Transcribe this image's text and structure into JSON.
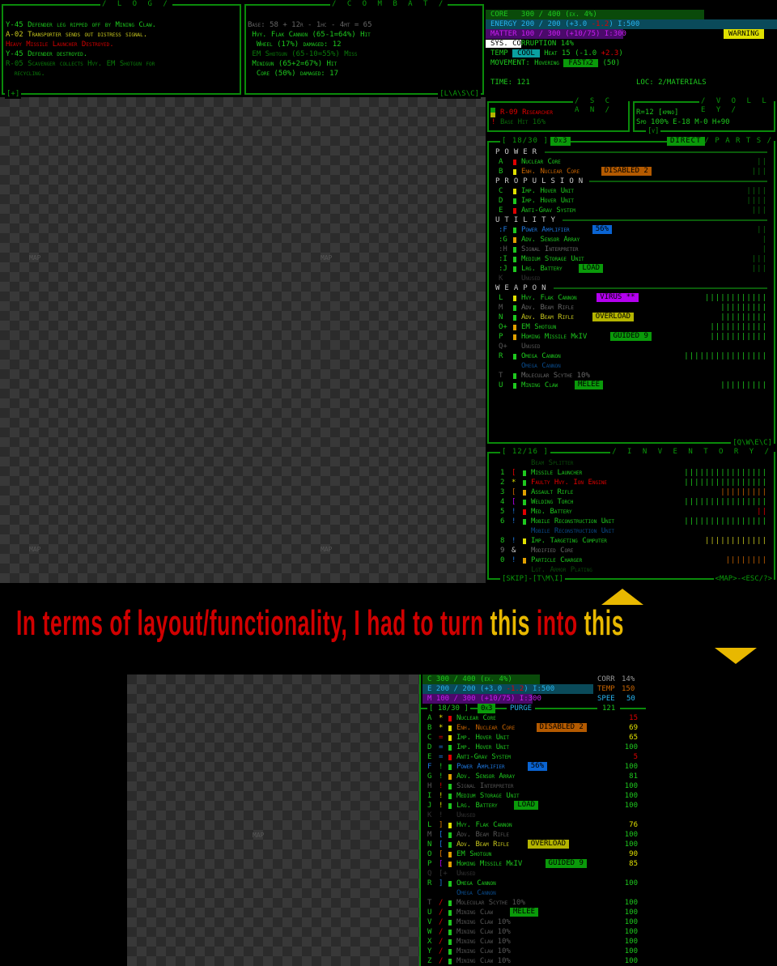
{
  "colors": {
    "green": "#1ec81e",
    "accent": "#0a8a0a",
    "caption_red": "#d00000",
    "caption_yellow": "#e8b800"
  },
  "log": {
    "title": "/ L O G /",
    "footer": "[+]",
    "lines": [
      {
        "text": "Y-45 Defender leg ripped off by Mining Claw.",
        "color": "#1ec81e"
      },
      {
        "text": "A-02 Transporter sends out distress signal.",
        "color": "#c8c81e"
      },
      {
        "text": "Heavy Missile Launcher Destroyed.",
        "color": "#d00000"
      },
      {
        "text": "Y-45 Defender destroyed.",
        "color": "#1ec81e"
      },
      {
        "text": "R-05 Scavenger collects Hvy. EM Shotgun for",
        "color": "#0a7a0a"
      },
      {
        "text": "  recycling.",
        "color": "#0a7a0a"
      }
    ]
  },
  "combat": {
    "title": "/ C O M B A T /",
    "footer": "[L\\A\\S\\C]",
    "lines": [
      {
        "text": "Base: 58 + 12r - 1hc - 4mt = 65",
        "color": "#666"
      },
      {
        "text": " Hvy. Flak Cannon (65-1=64%) Hit",
        "color": "#1ec81e"
      },
      {
        "text": "  Wheel (17%) damaged: 12",
        "color": "#1ec81e"
      },
      {
        "text": " EM Shotgun (65-10=55%) Miss",
        "color": "#0a7a0a"
      },
      {
        "text": " Minigun (65+2=67%) Hit",
        "color": "#1ec81e"
      },
      {
        "text": "  Core (50%) damaged: 17",
        "color": "#1ec81e"
      }
    ]
  },
  "status": {
    "core": "CORE   300 / 400 (ex. 4%)",
    "energy": "ENERGY 200 / 200 (+3.0 ",
    "energy_neg": "-1.2",
    "energy_end": ") I:500",
    "matter": "MATTER 100 / 300 (+10/75) I:300",
    "warning": "WARNING",
    "corruption_hl": "SYS. CO",
    "corruption_rest": "RRUPTION 14%",
    "temp_label": "TEMP ",
    "temp_state": "COOL",
    "heat": " Heat 15 (-1.0 ",
    "heat_pos": "+2.3",
    "heat_end": ")",
    "movement": "MOVEMENT: Hovering ",
    "speed_tag": "FASTx2",
    "speed_val": " (50)",
    "time": "TIME: 121",
    "loc": "LOC: 2/MATERIALS"
  },
  "scan": {
    "title": "/ S C A N /",
    "target": "R-09 Researcher",
    "hit": "Base Hit 16%",
    "hit_icon": "!"
  },
  "volley": {
    "title": "/ V O L L E Y /",
    "range": "R=12 [kmno]",
    "stats": "Spd 100% E-18 M-0 H+90",
    "footer": "[v]"
  },
  "parts": {
    "title": "/ P A R T S /",
    "count": "[ 18/30 ]",
    "mode": "0x3",
    "direct": "DIRECT",
    "footer": "[Q\\W\\E\\C]",
    "rows": [
      {
        "section": "POWER"
      },
      {
        "key": "A",
        "marker": "#e00000",
        "name": "Nuclear Core",
        "color": "#1ec81e",
        "bars": "||",
        "barcolor": "#0a6a0a"
      },
      {
        "key": "B",
        "marker": "#e0e000",
        "name": "Enh. Nuclear Core",
        "color": "#c86400",
        "tag": "DISABLED 2",
        "tagbg": "#b45a00",
        "bars": "|||",
        "barcolor": "#0a6a0a"
      },
      {
        "section": "PROPULSION"
      },
      {
        "key": "C",
        "marker": "#e0e000",
        "name": "Imp. Hover Unit",
        "color": "#1ec81e",
        "bars": "||||",
        "barcolor": "#0a6a0a"
      },
      {
        "key": "D",
        "marker": "#1ec81e",
        "name": "Imp. Hover Unit",
        "color": "#1ec81e",
        "bars": "||||",
        "barcolor": "#0a6a0a"
      },
      {
        "key": "E",
        "marker": "#e00000",
        "name": "Anti-Grav System",
        "color": "#1ec81e",
        "bars": "|||",
        "barcolor": "#0a6a0a"
      },
      {
        "section": "UTILITY"
      },
      {
        "key": ":F",
        "keycolor": "#1e78e0",
        "marker": "#1ec81e",
        "name": "Power Amplifier",
        "color": "#1e78e0",
        "tag": "56%",
        "tagbg": "#0a64d2",
        "bars": "||",
        "barcolor": "#0a6a0a"
      },
      {
        "key": ":G",
        "marker": "#e0a000",
        "name": "Adv. Sensor Array",
        "color": "#1ec81e",
        "bars": "|",
        "barcolor": "#0a6a0a"
      },
      {
        "key": ":H",
        "keycolor": "#555",
        "marker": "#1ec81e",
        "name": "Signal Interpreter",
        "color": "#666",
        "bars": "|",
        "barcolor": "#0a6a0a"
      },
      {
        "key": ":I",
        "marker": "#1ec81e",
        "name": "Medium Storage Unit",
        "color": "#1ec81e",
        "bars": "|||",
        "barcolor": "#0a6a0a"
      },
      {
        "key": ":J",
        "marker": "#1ec81e",
        "name": "Lrg. Battery",
        "color": "#1ec81e",
        "tag": "LOAD",
        "tagbg": "#0a9a0a",
        "bars": "|||",
        "barcolor": "#0a6a0a"
      },
      {
        "key": "K",
        "keycolor": "#333",
        "name": "Unused",
        "color": "#333"
      },
      {
        "section": "WEAPON"
      },
      {
        "key": "L",
        "marker": "#e0e000",
        "name": "Hvy. Flak Cannon",
        "color": "#1ec81e",
        "tag": "VIRUS **",
        "tagbg": "#b400f0",
        "bars": "||||||||||||",
        "barcolor": "#1ec81e"
      },
      {
        "key": "M",
        "keycolor": "#555",
        "marker": "#1ec81e",
        "name": "Adv. Beam Rifle",
        "color": "#666",
        "bars": "|||||||||",
        "barcolor": "#1ec81e"
      },
      {
        "key": "N",
        "marker": "#1ec81e",
        "name": "Adv. Beam Rifle",
        "color": "#c8c81e",
        "tag": "OVERLOAD",
        "tagbg": "#b4b400",
        "bars": "|||||||||",
        "barcolor": "#1ec81e"
      },
      {
        "key": "O+",
        "marker": "#e0a000",
        "name": "EM Shotgun",
        "color": "#1ec81e",
        "bars": "|||||||||||",
        "barcolor": "#1ec81e"
      },
      {
        "key": "P",
        "marker": "#e0a000",
        "name": "Homing Missile MkIV",
        "color": "#1ec81e",
        "tag": "GUIDED 9",
        "tagbg": "#0a9a0a",
        "bars": "|||||||||||",
        "barcolor": "#1ec81e"
      },
      {
        "key": "Q+",
        "keycolor": "#555",
        "name": "Unused",
        "color": "#555"
      },
      {
        "key": "R",
        "marker": "#1ec81e",
        "name": "Omega Cannon",
        "color": "#1ec81e",
        "bars": "||||||||||||||||",
        "barcolor": "#1ec81e"
      },
      {
        "name": "Omega Cannon",
        "color": "#0a4a8a"
      },
      {
        "key": "T",
        "keycolor": "#555",
        "marker": "#1ec81e",
        "name": "Molecular Scythe 10%",
        "color": "#666",
        "bars": ""
      },
      {
        "key": "U",
        "marker": "#1ec81e",
        "name": "Mining Claw",
        "color": "#1ec81e",
        "tag": "MELEE",
        "tagbg": "#0a9a0a",
        "bars": "|||||||||",
        "barcolor": "#1ec81e"
      }
    ]
  },
  "inventory": {
    "title": "/ I N V E N T O R Y /",
    "count": "[ 12/16 ]",
    "footer_left": "[SKIP]-[T\\M\\I]",
    "footer_right": "<MAP>-<ESC/?>",
    "rows": [
      {
        "name": "Beam Splitter",
        "color": "#0a4a0a"
      },
      {
        "key": "1",
        "sym": "[",
        "symcolor": "#e00000",
        "marker": "#1ec81e",
        "name": "Missile Launcher",
        "color": "#1ec81e",
        "bars": "||||||||||||||||",
        "barcolor": "#1ec81e"
      },
      {
        "key": "2",
        "sym": "*",
        "symcolor": "#e0e000",
        "marker": "#1ec81e",
        "name": "Faulty Hvy. Ion Engine",
        "color": "#e00000",
        "bars": "||||||||||||||||",
        "barcolor": "#1ec81e"
      },
      {
        "key": "3",
        "sym": "[",
        "symcolor": "#c86400",
        "marker": "#e0a000",
        "name": "Assault Rifle",
        "color": "#1ec81e",
        "bars": "|||||||||",
        "barcolor": "#c86400"
      },
      {
        "key": "4",
        "sym": "[",
        "symcolor": "#b400f0",
        "marker": "#1ec81e",
        "name": "Welding Torch",
        "color": "#1ec81e",
        "bars": "||||||||||||||||",
        "barcolor": "#1ec81e"
      },
      {
        "key": "5",
        "sym": "!",
        "symcolor": "#1e78e0",
        "marker": "#e00000",
        "name": "Med. Battery",
        "color": "#1ec81e",
        "bars": "||",
        "barcolor": "#e00000"
      },
      {
        "key": "6",
        "sym": "!",
        "symcolor": "#1e78e0",
        "marker": "#1ec81e",
        "name": "Mobile Reconstruction Unit",
        "color": "#1ec81e",
        "bars": "||||||||||||||||",
        "barcolor": "#1ec81e"
      },
      {
        "name": "Mobile Reconstruction Unit",
        "color": "#0a4a8a"
      },
      {
        "key": "8",
        "sym": "!",
        "symcolor": "#1e78e0",
        "marker": "#e0e000",
        "name": "Imp. Targeting Computer",
        "color": "#1ec81e",
        "bars": "||||||||||||",
        "barcolor": "#c8c81e"
      },
      {
        "key": "9",
        "keycolor": "#777",
        "sym": "&",
        "symcolor": "#ccc",
        "name": "Modified Core",
        "color": "#666"
      },
      {
        "key": "0",
        "sym": "!",
        "symcolor": "#1e78e0",
        "marker": "#e0a000",
        "name": "Particle Charger",
        "color": "#1ec81e",
        "bars": "||||||||",
        "barcolor": "#c86400"
      },
      {
        "name": "Lgt. Armor Plating",
        "color": "#0a4a0a"
      }
    ]
  },
  "map": {
    "label": "MAP"
  },
  "caption": {
    "text_a": "In terms of layout/functionality, I had to turn ",
    "this_1": "this",
    "text_b": " into ",
    "this_2": "this"
  },
  "compact": {
    "core": "C 300 / 400 (ex. 4%)",
    "energy": "E 200 / 200 (+3.0 ",
    "energy_neg": "-1.2",
    "energy_end": ") I:500",
    "matter": "M 100 / 300 (+10/75) I:300",
    "corr_label": "CORR",
    "corr": "14%",
    "temp_label": "TEMP",
    "temp": "150",
    "speed_label": "SPEE",
    "speed": "50",
    "count": "[ 18/30 ]",
    "mode": "0x3",
    "purge": "PURGE",
    "time": "121",
    "rows": [
      {
        "key": "A",
        "sym": "*",
        "symcolor": "#e0e000",
        "marker": "#e00000",
        "name": "Nuclear Core",
        "color": "#1ec81e",
        "val": "15",
        "valcolor": "#e00000"
      },
      {
        "key": "B",
        "sym": "*",
        "symcolor": "#e0e000",
        "marker": "#e0e000",
        "name": "Enh. Nuclear Core",
        "color": "#c86400",
        "tag": "DISABLED 2",
        "tagbg": "#b45a00",
        "val": "69",
        "valcolor": "#e0e000"
      },
      {
        "key": "C",
        "sym": "=",
        "symcolor": "#e00000",
        "marker": "#e0e000",
        "name": "Imp. Hover Unit",
        "color": "#1ec81e",
        "val": "65",
        "valcolor": "#e0e000"
      },
      {
        "key": "D",
        "sym": "=",
        "symcolor": "#1e78e0",
        "marker": "#1ec81e",
        "name": "Imp. Hover Unit",
        "color": "#1ec81e",
        "val": "100",
        "valcolor": "#1ec81e"
      },
      {
        "key": "E",
        "sym": "=",
        "symcolor": "#1e78e0",
        "marker": "#e00000",
        "name": "Anti-Grav System",
        "color": "#1ec81e",
        "val": "5",
        "valcolor": "#e00000"
      },
      {
        "key": "F",
        "keycolor": "#1e78e0",
        "sym": "!",
        "symcolor": "#1ec81e",
        "marker": "#1ec81e",
        "name": "Power Amplifier",
        "color": "#1e78e0",
        "tag": "56%",
        "tagbg": "#0a64d2",
        "val": "100",
        "valcolor": "#1ec81e"
      },
      {
        "key": "G",
        "sym": "!",
        "symcolor": "#1ec81e",
        "marker": "#e0a000",
        "name": "Adv. Sensor Array",
        "color": "#1ec81e",
        "val": "81",
        "valcolor": "#1ec81e"
      },
      {
        "key": "H",
        "keycolor": "#555",
        "sym": "!",
        "symcolor": "#e00000",
        "marker": "#1ec81e",
        "name": "Signal Interpreter",
        "color": "#555",
        "val": "100",
        "valcolor": "#1ec81e"
      },
      {
        "key": "I",
        "sym": "!",
        "symcolor": "#e0e000",
        "marker": "#1ec81e",
        "name": "Medium Storage Unit",
        "color": "#1ec81e",
        "val": "100",
        "valcolor": "#1ec81e"
      },
      {
        "key": "J",
        "sym": "!",
        "symcolor": "#e0e000",
        "marker": "#1ec81e",
        "name": "Lrg. Battery",
        "color": "#1ec81e",
        "tag": "LOAD",
        "tagbg": "#0a9a0a",
        "val": "100",
        "valcolor": "#1ec81e"
      },
      {
        "key": "K",
        "keycolor": "#333",
        "sym": "!",
        "symcolor": "#333",
        "name": "Unused",
        "color": "#333"
      },
      {
        "key": "L",
        "sym": "]",
        "symcolor": "#e07800",
        "marker": "#e0e000",
        "name": "Hvy. Flak Cannon",
        "color": "#1ec81e",
        "val": "76",
        "valcolor": "#e0e000"
      },
      {
        "key": "M",
        "keycolor": "#555",
        "sym": "[",
        "symcolor": "#1e78e0",
        "marker": "#1ec81e",
        "name": "Adv. Beam Rifle",
        "color": "#555",
        "val": "100",
        "valcolor": "#1ec81e"
      },
      {
        "key": "N",
        "sym": "[",
        "symcolor": "#1e78e0",
        "marker": "#1ec81e",
        "name": "Adv. Beam Rifle",
        "color": "#c8c81e",
        "tag": "OVERLOAD",
        "tagbg": "#b4b400",
        "val": "100",
        "valcolor": "#1ec81e"
      },
      {
        "key": "O",
        "sym": "[",
        "symcolor": "#e07800",
        "marker": "#e0a000",
        "name": "EM Shotgun",
        "color": "#1ec81e",
        "val": "90",
        "valcolor": "#e0e000"
      },
      {
        "key": "P",
        "sym": "[",
        "symcolor": "#b400f0",
        "marker": "#e0a000",
        "name": "Homing Missile MkIV",
        "color": "#1ec81e",
        "tag": "GUIDED 9",
        "tagbg": "#0a9a0a",
        "val": "85",
        "valcolor": "#e0e000"
      },
      {
        "key": "Q",
        "keycolor": "#333",
        "sym": "[+",
        "symcolor": "#333",
        "name": "Unused",
        "color": "#333"
      },
      {
        "key": "R",
        "sym": "]",
        "symcolor": "#1e78e0",
        "marker": "#1ec81e",
        "name": "Omega Cannon",
        "color": "#1ec81e",
        "val": "100",
        "valcolor": "#1ec81e"
      },
      {
        "name": "Omega Cannon",
        "color": "#0a4a8a"
      },
      {
        "key": "T",
        "keycolor": "#555",
        "sym": "/",
        "symcolor": "#e00000",
        "marker": "#1ec81e",
        "name": "Molecular Scythe 10%",
        "color": "#555",
        "val": "100",
        "valcolor": "#1ec81e"
      },
      {
        "key": "U",
        "sym": "/",
        "symcolor": "#e00000",
        "marker": "#1ec81e",
        "name": "Mining Claw",
        "color": "#555",
        "tag": "MELEE",
        "tagbg": "#0a9a0a",
        "val": "100",
        "valcolor": "#1ec81e"
      },
      {
        "key": "V",
        "sym": "/",
        "symcolor": "#e00000",
        "marker": "#1ec81e",
        "name": "Mining Claw 10%",
        "color": "#555",
        "val": "100",
        "valcolor": "#1ec81e"
      },
      {
        "key": "W",
        "sym": "/",
        "symcolor": "#e00000",
        "marker": "#1ec81e",
        "name": "Mining Claw 10%",
        "color": "#555",
        "val": "100",
        "valcolor": "#1ec81e"
      },
      {
        "key": "X",
        "sym": "/",
        "symcolor": "#e00000",
        "marker": "#1ec81e",
        "name": "Mining Claw 10%",
        "color": "#555",
        "val": "100",
        "valcolor": "#1ec81e"
      },
      {
        "key": "Y",
        "sym": "/",
        "symcolor": "#e00000",
        "marker": "#1ec81e",
        "name": "Mining Claw 10%",
        "color": "#555",
        "val": "100",
        "valcolor": "#1ec81e"
      },
      {
        "key": "Z",
        "sym": "/",
        "symcolor": "#e00000",
        "marker": "#1ec81e",
        "name": "Mining Claw 10%",
        "color": "#555",
        "val": "100",
        "valcolor": "#1ec81e"
      }
    ]
  }
}
